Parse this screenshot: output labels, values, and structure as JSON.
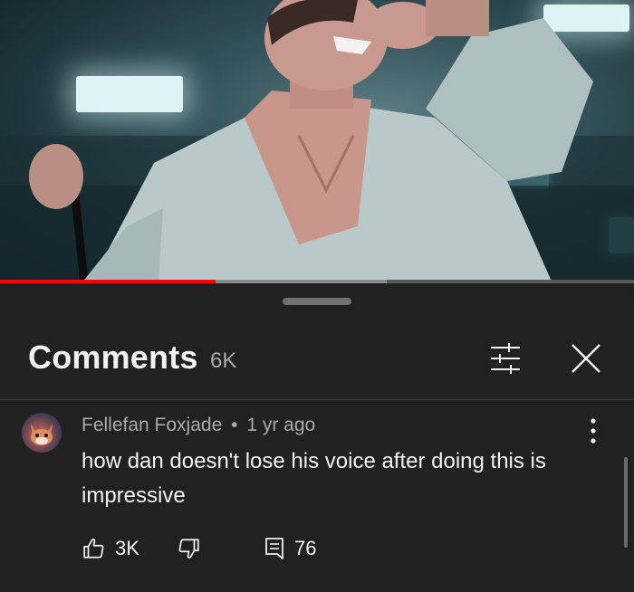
{
  "video": {
    "progress_played": 0.34,
    "progress_buffered": 0.61
  },
  "comments_panel": {
    "title": "Comments",
    "count": "6K",
    "icons": {
      "filter": "filter-sliders-icon",
      "close": "close-icon"
    }
  },
  "comment": {
    "author": "Fellefan Foxjade",
    "separator": "•",
    "time": "1 yr ago",
    "text": "how dan doesn't lose his voice after doing this is impressive",
    "likes": "3K",
    "replies": "76",
    "icons": {
      "like": "thumbs-up-icon",
      "dislike": "thumbs-down-icon",
      "reply": "reply-icon",
      "more": "more-vert-icon"
    }
  },
  "colors": {
    "background": "#212121",
    "progress": "#ff0000",
    "text_primary": "#f1f1f1",
    "text_secondary": "#aaaaaa"
  }
}
